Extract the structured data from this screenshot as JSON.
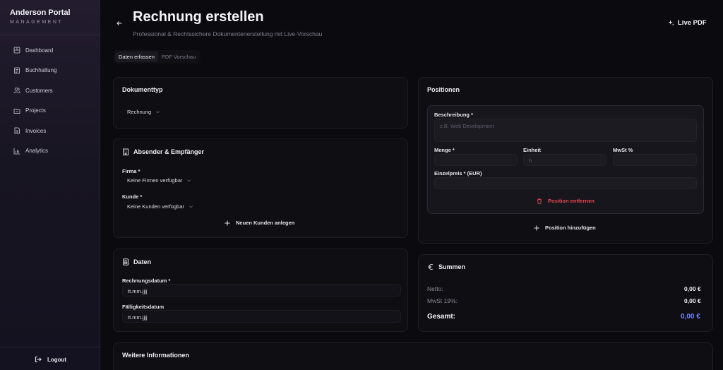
{
  "brand": {
    "title": "Anderson Portal",
    "subtitle": "MANAGEMENT"
  },
  "sidebar": {
    "items": [
      {
        "label": "Dashboard",
        "icon": "grid-icon"
      },
      {
        "label": "Buchhaltung",
        "icon": "document-icon"
      },
      {
        "label": "Customers",
        "icon": "users-icon"
      },
      {
        "label": "Projects",
        "icon": "folder-icon"
      },
      {
        "label": "Invoices",
        "icon": "invoice-icon"
      },
      {
        "label": "Analytics",
        "icon": "chart-icon"
      }
    ],
    "logout": "Logout"
  },
  "header": {
    "title": "Rechnung erstellen",
    "subtitle": "Professional & Rechtssichere Dokumentenerstellung mit Live-Vorschau",
    "live_pdf": "Live PDF"
  },
  "tabs": [
    {
      "label": "Daten erfassen",
      "active": true
    },
    {
      "label": "PDF Vorschau",
      "active": false
    }
  ],
  "doc_type": {
    "title": "Dokumenttyp",
    "value": "Rechnung"
  },
  "parties": {
    "title": "Absender & Empfänger",
    "firma_label": "Firma *",
    "firma_value": "Keine Firmen verfügbar",
    "kunde_label": "Kunde *",
    "kunde_value": "Keine Kunden verfügbar",
    "new_customer": "Neuen Kunden anlegen"
  },
  "dates": {
    "title": "Daten",
    "invoice_date_label": "Rechnungsdatum *",
    "invoice_date_value": "tt.mm.jjjj",
    "due_date_label": "Fälligkeitsdatum",
    "due_date_value": "tt.mm.jjjj"
  },
  "more": {
    "title": "Weitere Informationen"
  },
  "positions": {
    "title": "Positionen",
    "description_label": "Beschreibung *",
    "description_placeholder": "z.B. Web Development",
    "quantity_label": "Menge *",
    "unit_label": "Einheit",
    "unit_placeholder": "h",
    "vat_label": "MwSt %",
    "unit_price_label": "Einzelpreis * (EUR)",
    "remove": "Position entfernen",
    "add": "Position hinzufügen"
  },
  "totals": {
    "title": "Summen",
    "net_label": "Netto:",
    "net_value": "0,00 €",
    "vat_label": "MwSt 19%:",
    "vat_value": "0,00 €",
    "total_label": "Gesamt:",
    "total_value": "0,00 €"
  },
  "colors": {
    "accent_total": "#6f86ff",
    "danger": "#e5484d",
    "background": "#0b0b0f"
  }
}
